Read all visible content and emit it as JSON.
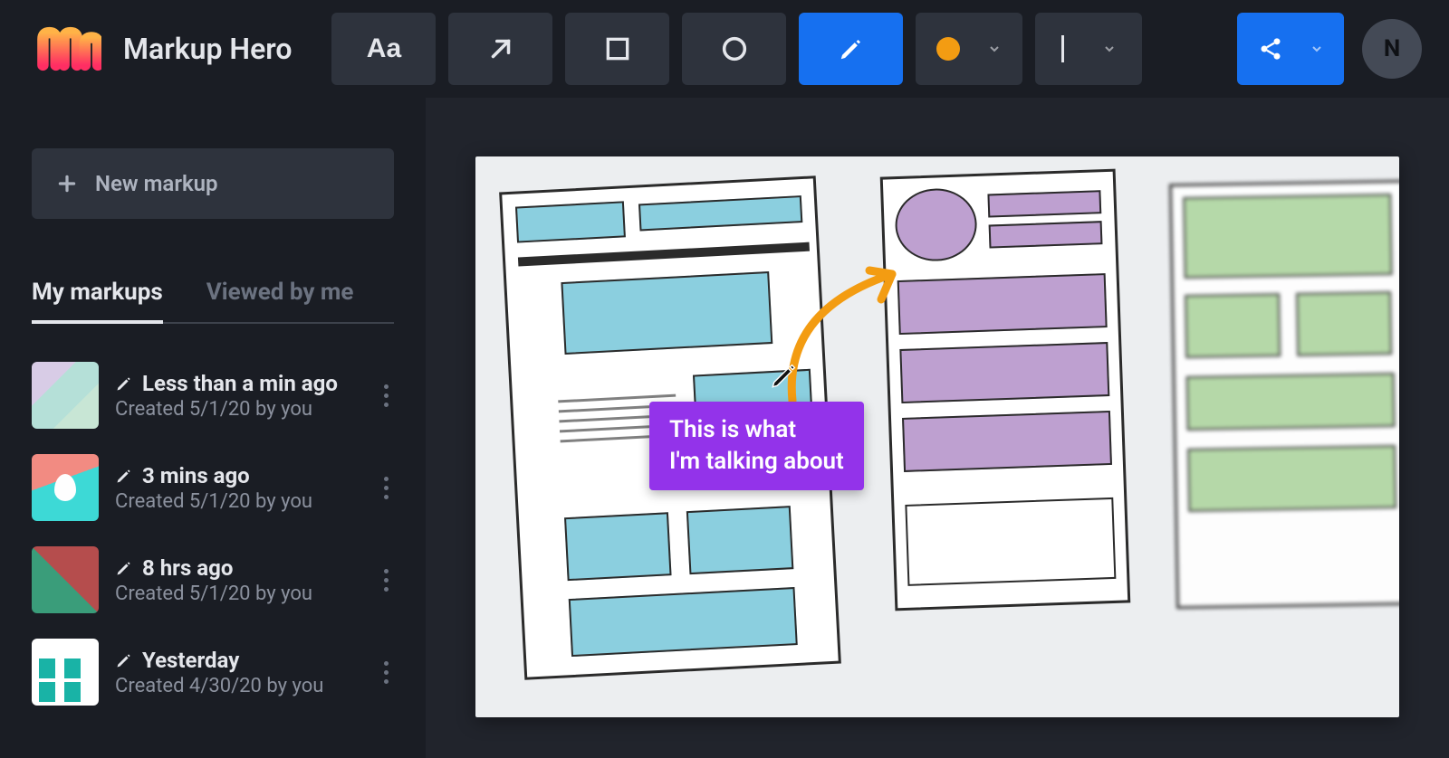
{
  "app": {
    "title": "Markup Hero"
  },
  "toolbar": {
    "text_label": "Aa",
    "tools": {
      "text": "text",
      "arrow": "arrow",
      "rectangle": "rectangle",
      "oval": "oval",
      "pen": "pen"
    },
    "color": "#f39c12",
    "stroke": "medium",
    "share": "share"
  },
  "user": {
    "initial": "N"
  },
  "sidebar": {
    "new_markup_label": "New markup",
    "tabs": [
      {
        "label": "My markups",
        "active": true
      },
      {
        "label": "Viewed by me",
        "active": false
      }
    ],
    "items": [
      {
        "title": "Less than a min ago",
        "subtitle": "Created 5/1/20 by you"
      },
      {
        "title": "3 mins ago",
        "subtitle": "Created 5/1/20 by you"
      },
      {
        "title": "8 hrs ago",
        "subtitle": "Created 5/1/20 by you"
      },
      {
        "title": "Yesterday",
        "subtitle": "Created 4/30/20 by you"
      }
    ]
  },
  "canvas": {
    "annotation": {
      "arrow_color": "#f39c12",
      "callout_text_line1": "This is what",
      "callout_text_line2": "I'm talking about",
      "callout_color": "#9333ea"
    }
  }
}
